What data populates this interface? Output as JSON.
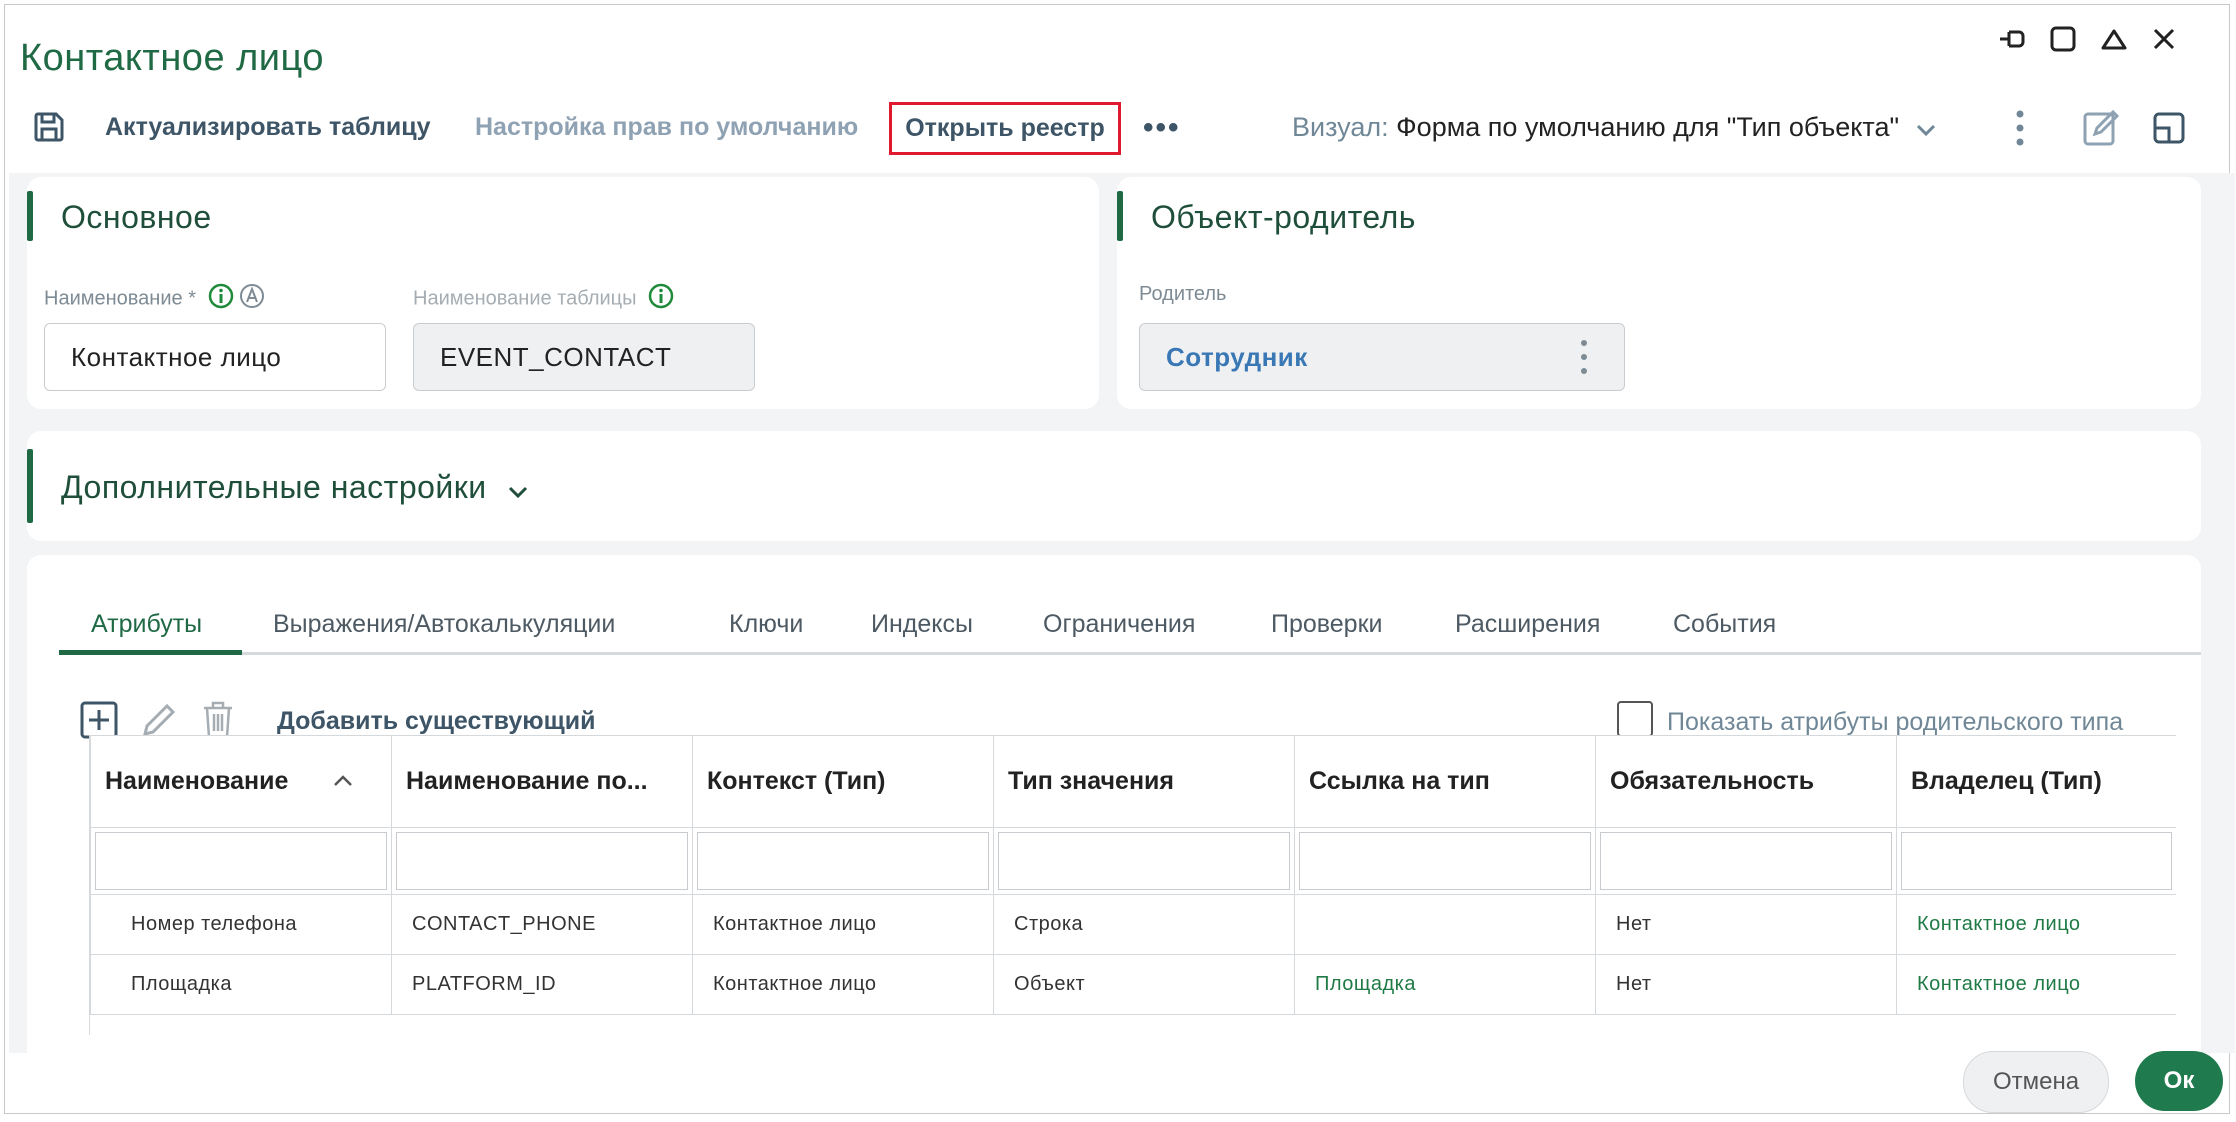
{
  "window": {
    "title": "Контактное лицо"
  },
  "toolbar": {
    "actualize_label": "Актуализировать таблицу",
    "rights_label": "Настройка прав по умолчанию",
    "open_registry_label": "Открыть реестр",
    "more_label": "•••",
    "visual_label": "Визуал:",
    "visual_value": "Форма по умолчанию для \"Тип объекта\""
  },
  "basic": {
    "title": "Основное",
    "name_label": "Наименование *",
    "name_value": "Контактное лицо",
    "table_label": "Наименование таблицы",
    "table_value": "EVENT_CONTACT"
  },
  "parent": {
    "title": "Объект-родитель",
    "label": "Родитель",
    "value": "Сотрудник"
  },
  "additional": {
    "title": "Дополнительные настройки"
  },
  "tabs": [
    {
      "label": "Атрибуты"
    },
    {
      "label": "Выражения/Автокалькуляции"
    },
    {
      "label": "Ключи"
    },
    {
      "label": "Индексы"
    },
    {
      "label": "Ограничения"
    },
    {
      "label": "Проверки"
    },
    {
      "label": "Расширения"
    },
    {
      "label": "События"
    }
  ],
  "attributes": {
    "add_existing_label": "Добавить существующий",
    "show_parent_label": "Показать атрибуты родительского типа",
    "columns": [
      "Наименование",
      "Наименование по...",
      "Контекст (Тип)",
      "Тип значения",
      "Ссылка на тип",
      "Обязательность",
      "Владелец (Тип)"
    ],
    "rows": [
      {
        "name": "Номер телефона",
        "db_name": "CONTACT_PHONE",
        "context": "Контактное лицо",
        "value_type": "Строка",
        "ref_type": "",
        "required": "Нет",
        "owner": "Контактное лицо"
      },
      {
        "name": "Площадка",
        "db_name": "PLATFORM_ID",
        "context": "Контактное лицо",
        "value_type": "Объект",
        "ref_type": "Площадка",
        "required": "Нет",
        "owner": "Контактное лицо"
      }
    ]
  },
  "footer": {
    "cancel_label": "Отмена",
    "ok_label": "Ок"
  },
  "colors": {
    "accent": "#1f6a45",
    "highlight": "#e0192e",
    "link": "#3a78b5"
  }
}
